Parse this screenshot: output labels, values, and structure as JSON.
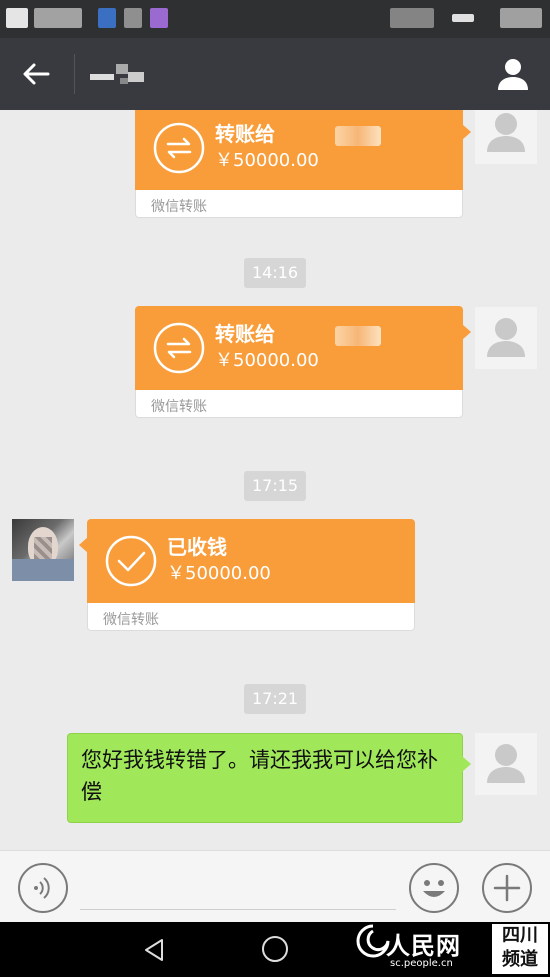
{
  "status_bar": {},
  "header": {
    "title_obscured": true
  },
  "messages": [
    {
      "kind": "transfer",
      "side": "right",
      "title": "转账给",
      "amount": "￥50000.00",
      "footer": "微信转账"
    },
    {
      "kind": "time",
      "text": "14:16"
    },
    {
      "kind": "transfer",
      "side": "right",
      "title": "转账给",
      "amount": "￥50000.00",
      "footer": "微信转账"
    },
    {
      "kind": "time",
      "text": "17:15"
    },
    {
      "kind": "transfer_received",
      "side": "left",
      "title": "已收钱",
      "amount": "￥50000.00",
      "footer": "微信转账"
    },
    {
      "kind": "time",
      "text": "17:21"
    },
    {
      "kind": "text",
      "side": "right",
      "text": "您好我钱转错了。请还我我可以给您补偿"
    }
  ],
  "input_bar": {
    "voice_icon": "voice-icon",
    "emoji_icon": "emoji-icon",
    "plus_icon": "plus-icon"
  },
  "watermark": {
    "logo": "人民网",
    "url": "sc.people.cn",
    "channel_line1": "四川",
    "channel_line2": "频道"
  },
  "colors": {
    "titlebar": "#393a3f",
    "transfer_orange": "#f99d3b",
    "bubble_green": "#a0e75a",
    "chat_bg": "#ebebeb"
  }
}
